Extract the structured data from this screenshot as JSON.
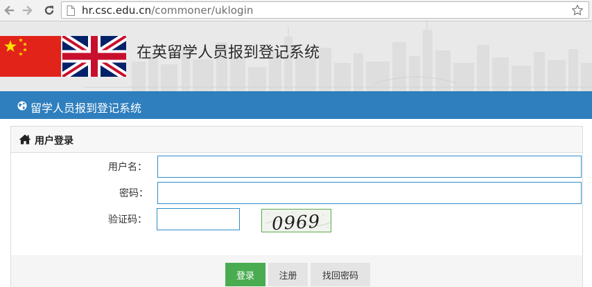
{
  "browser": {
    "url_host": "hr.csc.edu.cn",
    "url_path": "/commoner/uklogin"
  },
  "banner": {
    "site_title": "在英留学人员报到登记系统"
  },
  "navbar": {
    "title": "留学人员报到登记系统"
  },
  "login_panel": {
    "title": "用户登录",
    "username_label": "用户名：",
    "username_value": "",
    "password_label": "密码：",
    "password_value": "",
    "captcha_label": "验证码：",
    "captcha_value": "",
    "captcha_image_text": "0969"
  },
  "buttons": {
    "login": "登录",
    "register": "注册",
    "recover_password": "找回密码"
  },
  "colors": {
    "navbar": "#2f7fbe",
    "login_button": "#4aac50",
    "input_border": "#2f8bc9",
    "flag_red": "#e2231a",
    "flag_blue": "#012169"
  }
}
